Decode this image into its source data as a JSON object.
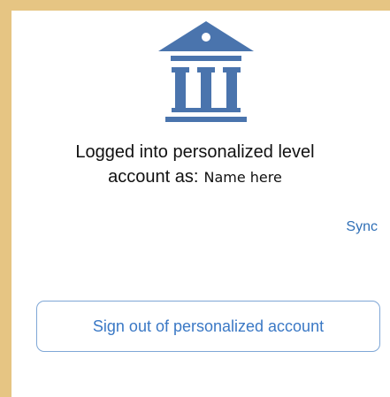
{
  "account": {
    "logo_icon": "bank-building-icon",
    "logo_color": "#4a74ad",
    "heading_line1": "Logged into personalized level",
    "heading_line2": "account as:",
    "user_name": "Name here",
    "sync_label": "Sync",
    "signout_label": "Sign out of personalized account"
  },
  "colors": {
    "page_background": "#e6c583",
    "panel_background": "#ffffff",
    "link_color": "#2f6fb6",
    "button_border": "#7fa7d6"
  }
}
